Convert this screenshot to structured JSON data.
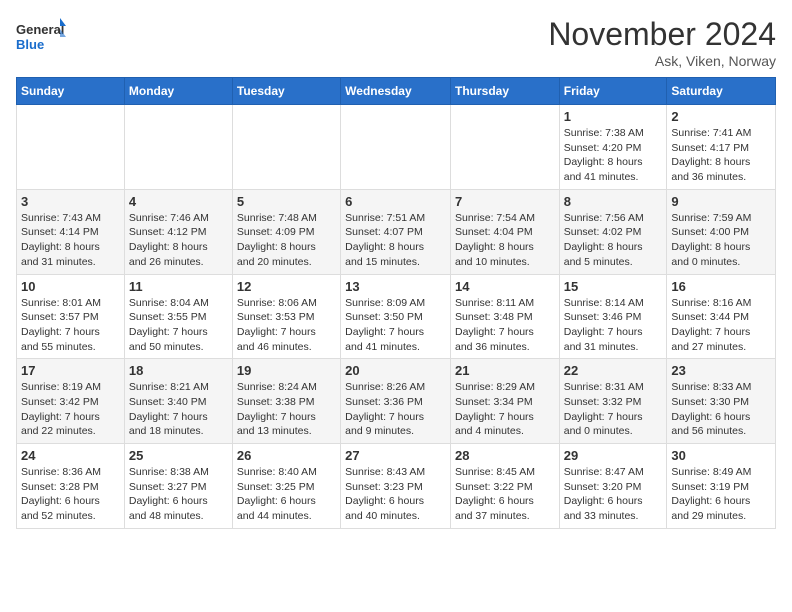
{
  "logo": {
    "line1": "General",
    "line2": "Blue"
  },
  "title": "November 2024",
  "location": "Ask, Viken, Norway",
  "days_header": [
    "Sunday",
    "Monday",
    "Tuesday",
    "Wednesday",
    "Thursday",
    "Friday",
    "Saturday"
  ],
  "weeks": [
    [
      {
        "day": "",
        "info": ""
      },
      {
        "day": "",
        "info": ""
      },
      {
        "day": "",
        "info": ""
      },
      {
        "day": "",
        "info": ""
      },
      {
        "day": "",
        "info": ""
      },
      {
        "day": "1",
        "info": "Sunrise: 7:38 AM\nSunset: 4:20 PM\nDaylight: 8 hours\nand 41 minutes."
      },
      {
        "day": "2",
        "info": "Sunrise: 7:41 AM\nSunset: 4:17 PM\nDaylight: 8 hours\nand 36 minutes."
      }
    ],
    [
      {
        "day": "3",
        "info": "Sunrise: 7:43 AM\nSunset: 4:14 PM\nDaylight: 8 hours\nand 31 minutes."
      },
      {
        "day": "4",
        "info": "Sunrise: 7:46 AM\nSunset: 4:12 PM\nDaylight: 8 hours\nand 26 minutes."
      },
      {
        "day": "5",
        "info": "Sunrise: 7:48 AM\nSunset: 4:09 PM\nDaylight: 8 hours\nand 20 minutes."
      },
      {
        "day": "6",
        "info": "Sunrise: 7:51 AM\nSunset: 4:07 PM\nDaylight: 8 hours\nand 15 minutes."
      },
      {
        "day": "7",
        "info": "Sunrise: 7:54 AM\nSunset: 4:04 PM\nDaylight: 8 hours\nand 10 minutes."
      },
      {
        "day": "8",
        "info": "Sunrise: 7:56 AM\nSunset: 4:02 PM\nDaylight: 8 hours\nand 5 minutes."
      },
      {
        "day": "9",
        "info": "Sunrise: 7:59 AM\nSunset: 4:00 PM\nDaylight: 8 hours\nand 0 minutes."
      }
    ],
    [
      {
        "day": "10",
        "info": "Sunrise: 8:01 AM\nSunset: 3:57 PM\nDaylight: 7 hours\nand 55 minutes."
      },
      {
        "day": "11",
        "info": "Sunrise: 8:04 AM\nSunset: 3:55 PM\nDaylight: 7 hours\nand 50 minutes."
      },
      {
        "day": "12",
        "info": "Sunrise: 8:06 AM\nSunset: 3:53 PM\nDaylight: 7 hours\nand 46 minutes."
      },
      {
        "day": "13",
        "info": "Sunrise: 8:09 AM\nSunset: 3:50 PM\nDaylight: 7 hours\nand 41 minutes."
      },
      {
        "day": "14",
        "info": "Sunrise: 8:11 AM\nSunset: 3:48 PM\nDaylight: 7 hours\nand 36 minutes."
      },
      {
        "day": "15",
        "info": "Sunrise: 8:14 AM\nSunset: 3:46 PM\nDaylight: 7 hours\nand 31 minutes."
      },
      {
        "day": "16",
        "info": "Sunrise: 8:16 AM\nSunset: 3:44 PM\nDaylight: 7 hours\nand 27 minutes."
      }
    ],
    [
      {
        "day": "17",
        "info": "Sunrise: 8:19 AM\nSunset: 3:42 PM\nDaylight: 7 hours\nand 22 minutes."
      },
      {
        "day": "18",
        "info": "Sunrise: 8:21 AM\nSunset: 3:40 PM\nDaylight: 7 hours\nand 18 minutes."
      },
      {
        "day": "19",
        "info": "Sunrise: 8:24 AM\nSunset: 3:38 PM\nDaylight: 7 hours\nand 13 minutes."
      },
      {
        "day": "20",
        "info": "Sunrise: 8:26 AM\nSunset: 3:36 PM\nDaylight: 7 hours\nand 9 minutes."
      },
      {
        "day": "21",
        "info": "Sunrise: 8:29 AM\nSunset: 3:34 PM\nDaylight: 7 hours\nand 4 minutes."
      },
      {
        "day": "22",
        "info": "Sunrise: 8:31 AM\nSunset: 3:32 PM\nDaylight: 7 hours\nand 0 minutes."
      },
      {
        "day": "23",
        "info": "Sunrise: 8:33 AM\nSunset: 3:30 PM\nDaylight: 6 hours\nand 56 minutes."
      }
    ],
    [
      {
        "day": "24",
        "info": "Sunrise: 8:36 AM\nSunset: 3:28 PM\nDaylight: 6 hours\nand 52 minutes."
      },
      {
        "day": "25",
        "info": "Sunrise: 8:38 AM\nSunset: 3:27 PM\nDaylight: 6 hours\nand 48 minutes."
      },
      {
        "day": "26",
        "info": "Sunrise: 8:40 AM\nSunset: 3:25 PM\nDaylight: 6 hours\nand 44 minutes."
      },
      {
        "day": "27",
        "info": "Sunrise: 8:43 AM\nSunset: 3:23 PM\nDaylight: 6 hours\nand 40 minutes."
      },
      {
        "day": "28",
        "info": "Sunrise: 8:45 AM\nSunset: 3:22 PM\nDaylight: 6 hours\nand 37 minutes."
      },
      {
        "day": "29",
        "info": "Sunrise: 8:47 AM\nSunset: 3:20 PM\nDaylight: 6 hours\nand 33 minutes."
      },
      {
        "day": "30",
        "info": "Sunrise: 8:49 AM\nSunset: 3:19 PM\nDaylight: 6 hours\nand 29 minutes."
      }
    ]
  ]
}
